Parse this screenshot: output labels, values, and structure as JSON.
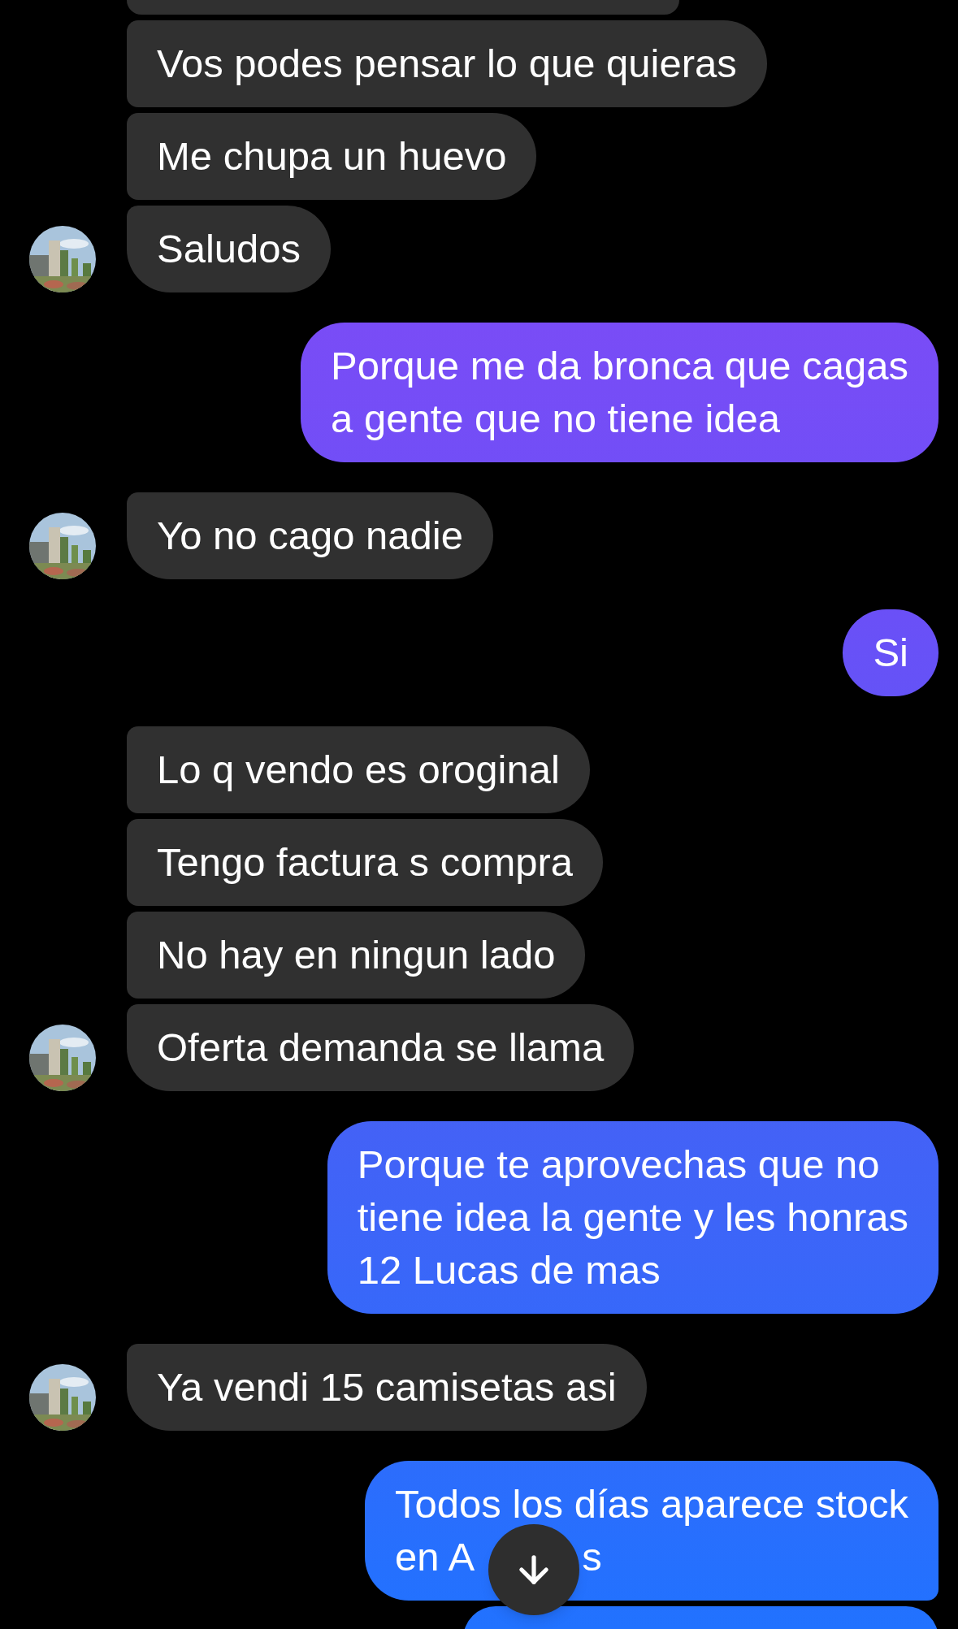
{
  "messages": [
    {
      "kind": "received_clipped"
    },
    {
      "kind": "received",
      "lines": [
        "Vos podes pensar lo que quieras"
      ],
      "avatar": false
    },
    {
      "kind": "received",
      "lines": [
        "Me chupa un huevo"
      ],
      "avatar": false
    },
    {
      "kind": "received",
      "lines": [
        "Saludos"
      ],
      "avatar": true
    },
    {
      "kind": "sent",
      "lines": [
        "Porque me da bronca que cagas",
        "a gente que no tiene idea"
      ]
    },
    {
      "kind": "received",
      "lines": [
        "Yo no cago nadie"
      ],
      "avatar": true
    },
    {
      "kind": "sent",
      "lines": [
        "Si"
      ]
    },
    {
      "kind": "received",
      "lines": [
        "Lo q vendo es oroginal"
      ],
      "avatar": false
    },
    {
      "kind": "received",
      "lines": [
        "Tengo factura s compra"
      ],
      "avatar": false
    },
    {
      "kind": "received",
      "lines": [
        "No hay en ningun lado"
      ],
      "avatar": false
    },
    {
      "kind": "received",
      "lines": [
        "Oferta demanda se llama"
      ],
      "avatar": true
    },
    {
      "kind": "sent",
      "lines": [
        "Porque te aprovechas que no",
        "tiene idea la gente y les honras",
        "12 Lucas de mas"
      ]
    },
    {
      "kind": "received",
      "lines": [
        "Ya vendi 15 camisetas asi"
      ],
      "avatar": true
    },
    {
      "kind": "sent_covered",
      "lines": [
        "Todos los días aparece stock",
        "en A"
      ],
      "tail": "s"
    },
    {
      "kind": "sent_clipped"
    }
  ]
}
